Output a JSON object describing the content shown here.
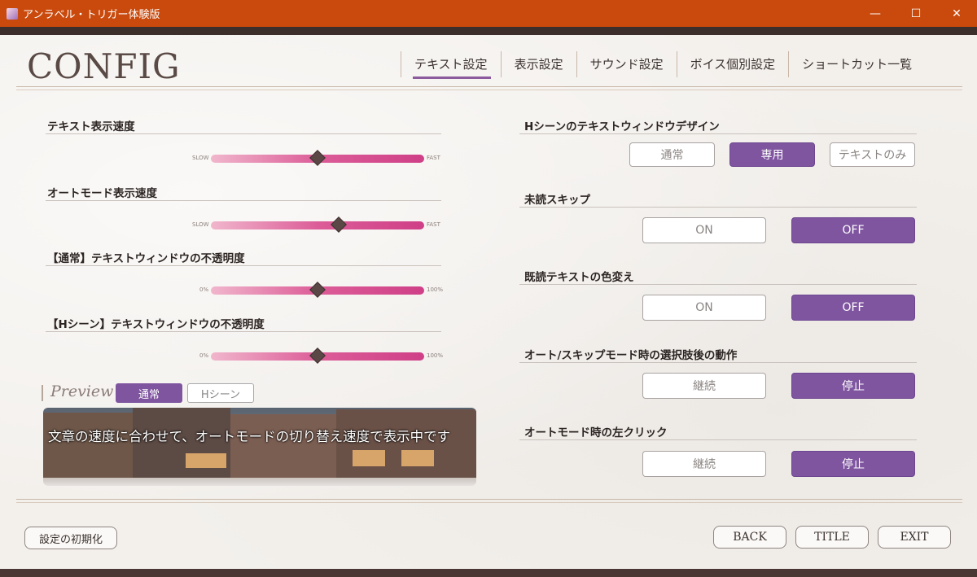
{
  "window": {
    "title": "アンラベル・トリガー体験版",
    "minimize": "—",
    "maximize": "☐",
    "close": "✕"
  },
  "header": {
    "title": "CONFIG"
  },
  "tabs": [
    {
      "label": "テキスト設定",
      "active": true
    },
    {
      "label": "表示設定",
      "active": false
    },
    {
      "label": "サウンド設定",
      "active": false
    },
    {
      "label": "ボイス個別設定",
      "active": false
    },
    {
      "label": "ショートカット一覧",
      "active": false
    }
  ],
  "sliders": [
    {
      "label": "テキスト表示速度",
      "min": "SLOW",
      "max": "FAST",
      "value": 0.5
    },
    {
      "label": "オートモード表示速度",
      "min": "SLOW",
      "max": "FAST",
      "value": 0.6
    },
    {
      "label": "【通常】テキストウィンドウの不透明度",
      "min": "0%",
      "max": "100%",
      "value": 0.5
    },
    {
      "label": "【Hシーン】テキストウィンドウの不透明度",
      "min": "0%",
      "max": "100%",
      "value": 0.5
    }
  ],
  "options": {
    "hscene_design": {
      "label": "Hシーンのテキストウィンドウデザイン",
      "choices": [
        "通常",
        "専用",
        "テキストのみ"
      ],
      "selected": "専用"
    },
    "unread_skip": {
      "label": "未読スキップ",
      "choices": [
        "ON",
        "OFF"
      ],
      "selected": "OFF"
    },
    "read_color": {
      "label": "既読テキストの色変え",
      "choices": [
        "ON",
        "OFF"
      ],
      "selected": "OFF"
    },
    "after_choice": {
      "label": "オート/スキップモード時の選択肢後の動作",
      "choices": [
        "継続",
        "停止"
      ],
      "selected": "停止"
    },
    "auto_left_click": {
      "label": "オートモード時の左クリック",
      "choices": [
        "継続",
        "停止"
      ],
      "selected": "停止"
    }
  },
  "preview": {
    "label": "Preview",
    "modes": [
      "通常",
      "Hシーン"
    ],
    "selected": "通常",
    "text": "文章の速度に合わせて、オートモードの切り替え速度で表示中です"
  },
  "footer": {
    "reset": "設定の初期化",
    "back": "BACK",
    "title": "TITLE",
    "exit": "EXIT"
  }
}
